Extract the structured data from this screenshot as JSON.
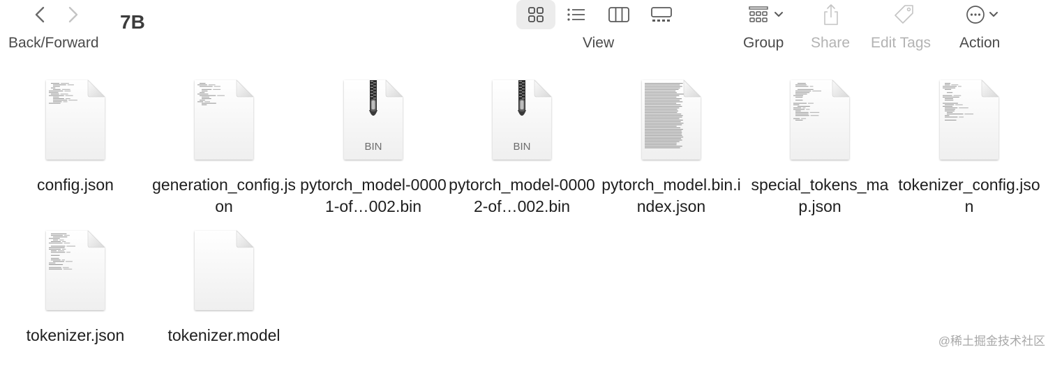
{
  "window": {
    "title": "7B"
  },
  "toolbar": {
    "back_forward_label": "Back/Forward",
    "view_label": "View",
    "group_label": "Group",
    "share_label": "Share",
    "edit_tags_label": "Edit Tags",
    "action_label": "Action",
    "selected_view": "icons"
  },
  "files": [
    {
      "name": "config.json",
      "icon": "json-document-icon",
      "badge": ""
    },
    {
      "name": "generation_config.json",
      "icon": "json-document-icon",
      "badge": ""
    },
    {
      "name": "pytorch_model-00001-of…002.bin",
      "icon": "zip-archive-icon",
      "badge": "BIN"
    },
    {
      "name": "pytorch_model-00002-of…002.bin",
      "icon": "zip-archive-icon",
      "badge": "BIN"
    },
    {
      "name": "pytorch_model.bin.index.json",
      "icon": "json-document-icon",
      "badge": ""
    },
    {
      "name": "special_tokens_map.json",
      "icon": "json-document-icon",
      "badge": ""
    },
    {
      "name": "tokenizer_config.json",
      "icon": "json-document-icon",
      "badge": ""
    },
    {
      "name": "tokenizer.json",
      "icon": "json-document-icon",
      "badge": ""
    },
    {
      "name": "tokenizer.model",
      "icon": "blank-document-icon",
      "badge": ""
    }
  ],
  "watermark": "@稀土掘金技术社区"
}
